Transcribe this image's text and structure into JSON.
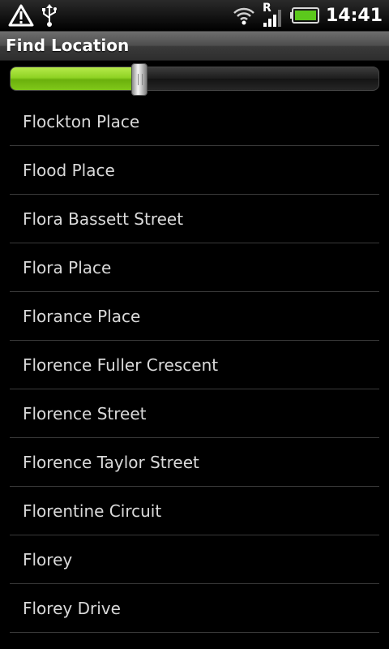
{
  "status_bar": {
    "time": "14:41",
    "left_icons": [
      "warning-icon",
      "usb-icon"
    ],
    "right_icons": [
      "wifi-icon",
      "signal-roaming-icon",
      "battery-icon"
    ],
    "roaming_label": "R",
    "battery_color": "#5cc81c"
  },
  "title_bar": {
    "title": "Find Location"
  },
  "seek_bar": {
    "progress_percent": 35,
    "fill_color": "#8fd324"
  },
  "location_list": {
    "items": [
      {
        "label": "Flockton Place"
      },
      {
        "label": "Flood Place"
      },
      {
        "label": "Flora Bassett Street"
      },
      {
        "label": "Flora Place"
      },
      {
        "label": "Florance Place"
      },
      {
        "label": "Florence Fuller Crescent"
      },
      {
        "label": "Florence Street"
      },
      {
        "label": "Florence Taylor Street"
      },
      {
        "label": "Florentine Circuit"
      },
      {
        "label": "Florey"
      },
      {
        "label": "Florey Drive"
      }
    ]
  }
}
